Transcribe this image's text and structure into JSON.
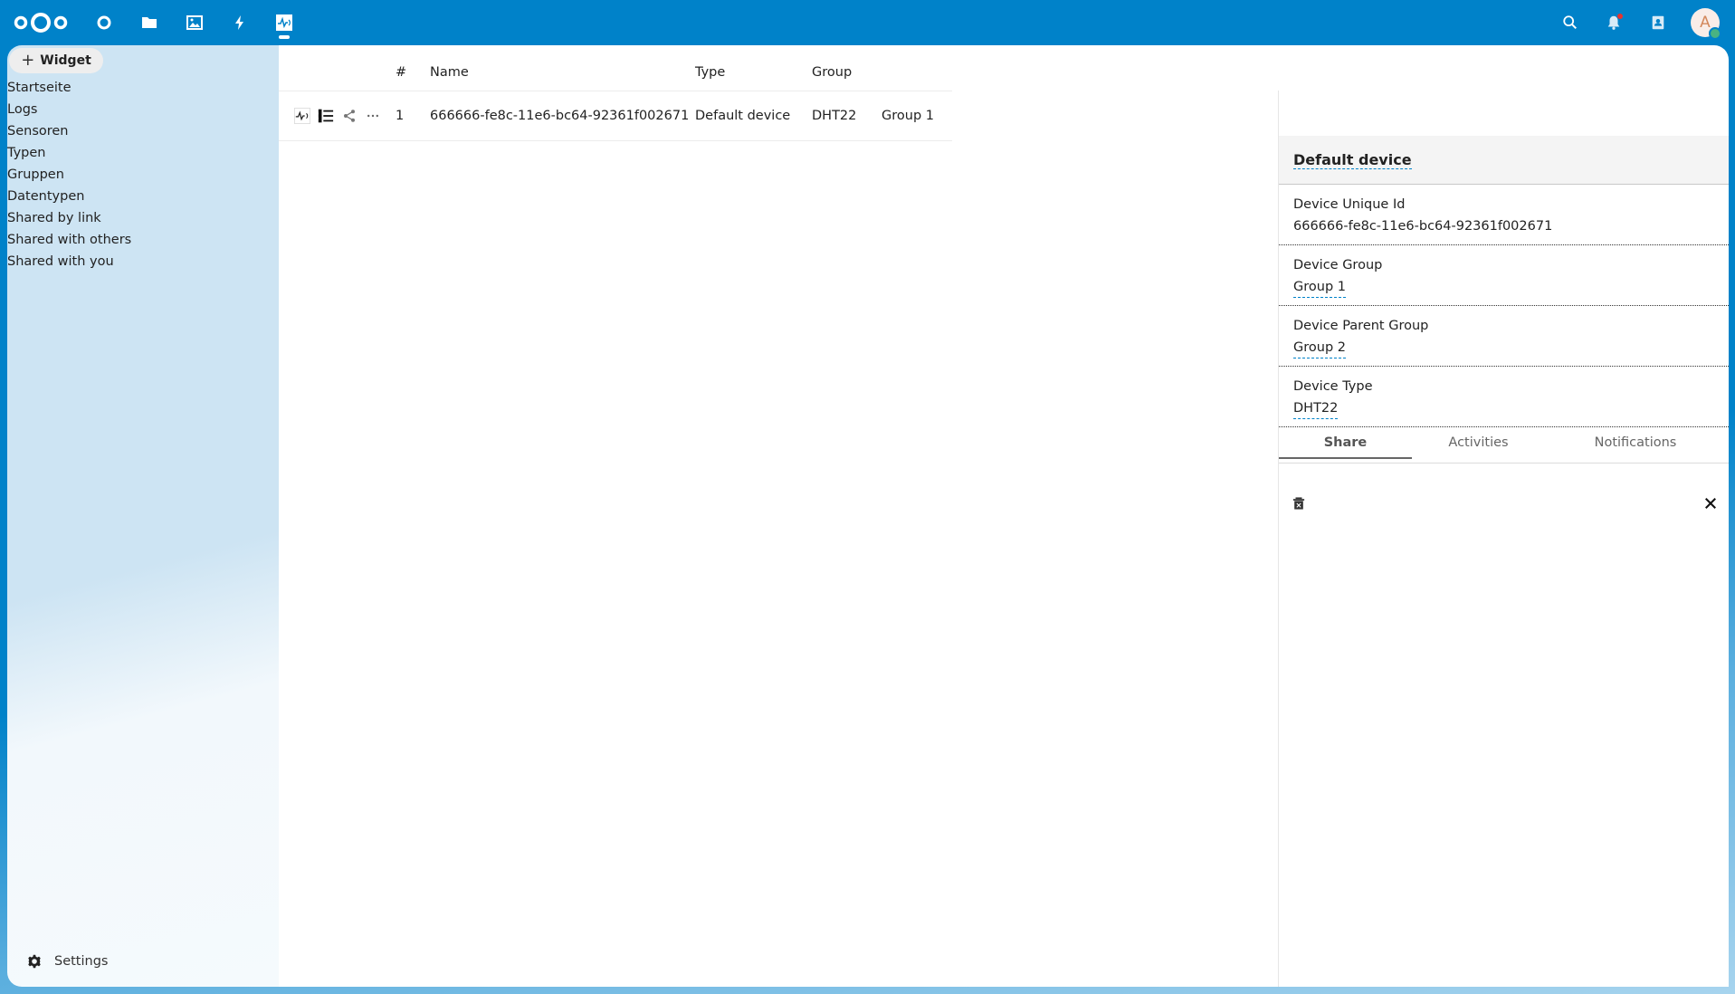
{
  "header": {
    "apps": [
      {
        "name": "dashboard",
        "icon": "circle-icon"
      },
      {
        "name": "files",
        "icon": "folder-icon"
      },
      {
        "name": "photos",
        "icon": "image-icon"
      },
      {
        "name": "activity",
        "icon": "lightning-icon"
      },
      {
        "name": "sensorlogger",
        "icon": "sensor-wave-icon",
        "active": true
      }
    ],
    "avatar_initial": "A",
    "brand_color": "#0082c9"
  },
  "sidebar": {
    "widget_button": "Widget",
    "items": [
      {
        "label": "Startseite"
      },
      {
        "label": "Logs"
      },
      {
        "label": "Sensoren"
      },
      {
        "label": "Typen"
      },
      {
        "label": "Gruppen"
      },
      {
        "label": "Datentypen"
      },
      {
        "label": "Shared by link"
      },
      {
        "label": "Shared with others"
      },
      {
        "label": "Shared with you"
      }
    ],
    "settings_label": "Settings"
  },
  "table": {
    "headers": [
      "#",
      "Name",
      "Type",
      "Group"
    ],
    "rows": [
      {
        "num": "1",
        "name": "666666-fe8c-11e6-bc64-92361f002671",
        "type": "Default device",
        "group": "DHT22",
        "extra": "Group 1"
      }
    ]
  },
  "details": {
    "title": "Default device",
    "fields": [
      {
        "label": "Device Unique Id",
        "value": "666666-fe8c-11e6-bc64-92361f002671"
      },
      {
        "label": "Device Group",
        "value": "Group 1"
      },
      {
        "label": "Device Parent Group",
        "value": "Group 2"
      },
      {
        "label": "Device Type",
        "value": "DHT22"
      }
    ],
    "tabs": [
      "Share",
      "Activities",
      "Notifications"
    ],
    "active_tab": "Share"
  }
}
